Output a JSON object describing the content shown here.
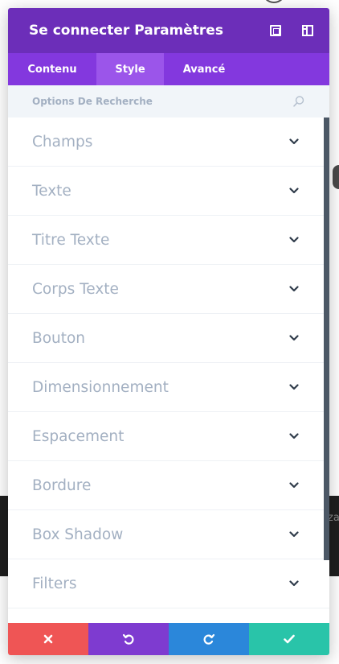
{
  "modal": {
    "title": "Se connecter Paramètres",
    "expand_icon": "expand-icon",
    "split_icon": "split-view-icon"
  },
  "tabs": [
    {
      "label": "Contenu",
      "active": false
    },
    {
      "label": "Style",
      "active": true
    },
    {
      "label": "Avancé",
      "active": false
    }
  ],
  "search": {
    "placeholder": "Options De Recherche",
    "icon": "search-icon"
  },
  "groups": [
    {
      "label": "Champs"
    },
    {
      "label": "Texte"
    },
    {
      "label": "Titre Texte"
    },
    {
      "label": "Corps Texte"
    },
    {
      "label": "Bouton"
    },
    {
      "label": "Dimensionnement"
    },
    {
      "label": "Espacement"
    },
    {
      "label": "Bordure"
    },
    {
      "label": "Box Shadow"
    },
    {
      "label": "Filters"
    }
  ],
  "footer": {
    "cancel_icon": "close-icon",
    "undo_icon": "undo-icon",
    "redo_icon": "redo-icon",
    "save_icon": "check-icon"
  },
  "background": {
    "side_text": "za"
  },
  "colors": {
    "header": "#6c2eb9",
    "tabs": "#8338de",
    "active_tab": "#9b55ea",
    "cancel": "#ef5555",
    "undo": "#7e3bd0",
    "redo": "#2b87da",
    "save": "#29c4a9"
  }
}
